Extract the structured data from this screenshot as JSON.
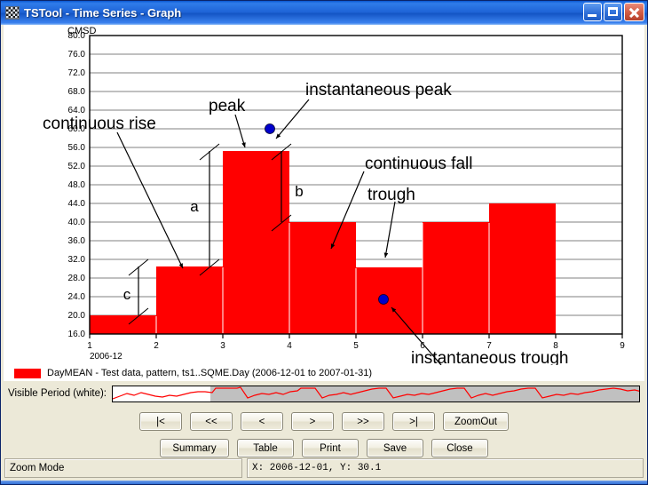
{
  "window": {
    "title": "TSTool - Time Series - Graph",
    "icon": "checkered-flag-icon",
    "minimize_label": "Minimize",
    "maximize_label": "Maximize",
    "close_label": "Close"
  },
  "chart_data": {
    "type": "bar",
    "title": "",
    "ylabel": "CMSD",
    "xlabel": "2006-12",
    "ylim": [
      16.0,
      80.0
    ],
    "ytick_step": 4.0,
    "yticks": [
      "80.0",
      "76.0",
      "72.0",
      "68.0",
      "64.0",
      "60.0",
      "56.0",
      "52.0",
      "48.0",
      "44.0",
      "40.0",
      "36.0",
      "32.0",
      "28.0",
      "24.0",
      "20.0",
      "16.0"
    ],
    "xlim": [
      1,
      9
    ],
    "xticks": [
      "1",
      "2",
      "3",
      "4",
      "5",
      "6",
      "7",
      "8",
      "9"
    ],
    "grid": true,
    "bar_color": "#ff0000",
    "categories": [
      1,
      2,
      3,
      4,
      5,
      6,
      7
    ],
    "values": [
      20.0,
      30.5,
      55.2,
      40.0,
      30.4,
      40.0,
      50.0
    ],
    "series": [
      {
        "name": "DayMEAN - Test data, pattern, ts1..SQME.Day (2006-12-01 to 2007-01-31)",
        "values": [
          20.0,
          30.5,
          55.2,
          40.0,
          30.4,
          40.0,
          50.0
        ]
      }
    ],
    "markers": [
      {
        "label": "instantaneous peak",
        "x": 3.65,
        "y": 61.8,
        "color": "#0000cc"
      },
      {
        "label": "instantaneous trough",
        "x": 5.5,
        "y": 25.6,
        "color": "#0000cc"
      }
    ],
    "annotations": [
      {
        "text": "continuous rise",
        "target": "bar-2-rise"
      },
      {
        "text": "peak",
        "target": "bar-3-top"
      },
      {
        "text": "instantaneous peak",
        "target": "marker-peak"
      },
      {
        "text": "continuous fall",
        "target": "bar-4-fall"
      },
      {
        "text": "trough",
        "target": "bar-5-top"
      },
      {
        "text": "instantaneous trough",
        "target": "marker-trough"
      }
    ],
    "measurements": [
      {
        "label": "a",
        "description": "rise from bar 2 top to bar 3 top"
      },
      {
        "label": "b",
        "description": "fall from bar 3 top to bar 4 top"
      },
      {
        "label": "c",
        "description": "rise from bar 1 top to bar 2 top"
      }
    ]
  },
  "legend": {
    "label": "DayMEAN - Test data, pattern, ts1..SQME.Day (2006-12-01 to 2007-01-31)",
    "swatch_color": "#ff0000"
  },
  "visible_period": {
    "label": "Visible Period (white):"
  },
  "nav_buttons": [
    {
      "label": "|<",
      "name": "nav-first"
    },
    {
      "label": "<<",
      "name": "nav-page-back"
    },
    {
      "label": "<",
      "name": "nav-back"
    },
    {
      "label": ">",
      "name": "nav-forward"
    },
    {
      "label": ">>",
      "name": "nav-page-forward"
    },
    {
      "label": ">|",
      "name": "nav-last"
    },
    {
      "label": "ZoomOut",
      "name": "nav-zoom-out"
    }
  ],
  "action_buttons": [
    {
      "label": "Summary",
      "name": "summary-button"
    },
    {
      "label": "Table",
      "name": "table-button"
    },
    {
      "label": "Print",
      "name": "print-button"
    },
    {
      "label": "Save",
      "name": "save-button"
    },
    {
      "label": "Close",
      "name": "close-button"
    }
  ],
  "status": {
    "mode": "Zoom Mode",
    "coordinates": "X: 2006-12-01, Y: 30.1"
  }
}
